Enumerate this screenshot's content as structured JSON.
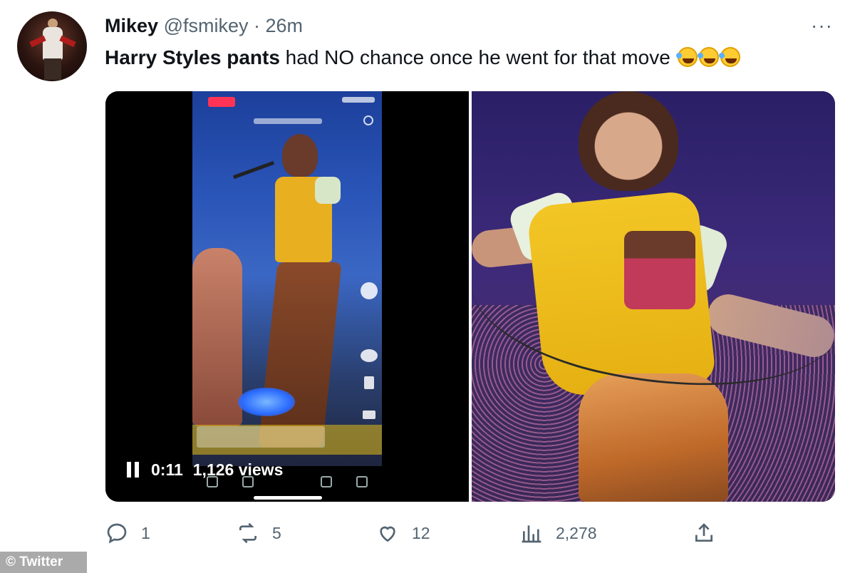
{
  "tweet": {
    "author_name": "Mikey",
    "handle": "@fsmikey",
    "separator": "·",
    "time": "26m",
    "more_label": "···",
    "text_bold": "Harry Styles pants",
    "text_rest": " had NO chance once he went for that move",
    "emoji_icon": "rolling-on-floor-laughing-emoji"
  },
  "video": {
    "elapsed": "0:11",
    "views": "1,126 views",
    "playback_state": "playing"
  },
  "actions": {
    "replies": "1",
    "reposts": "5",
    "likes": "12",
    "views": "2,278"
  },
  "watermark": "© Twitter",
  "colors": {
    "text_primary": "#0f1419",
    "text_secondary": "#536471",
    "emoji_yellow": "#ffcc33"
  }
}
